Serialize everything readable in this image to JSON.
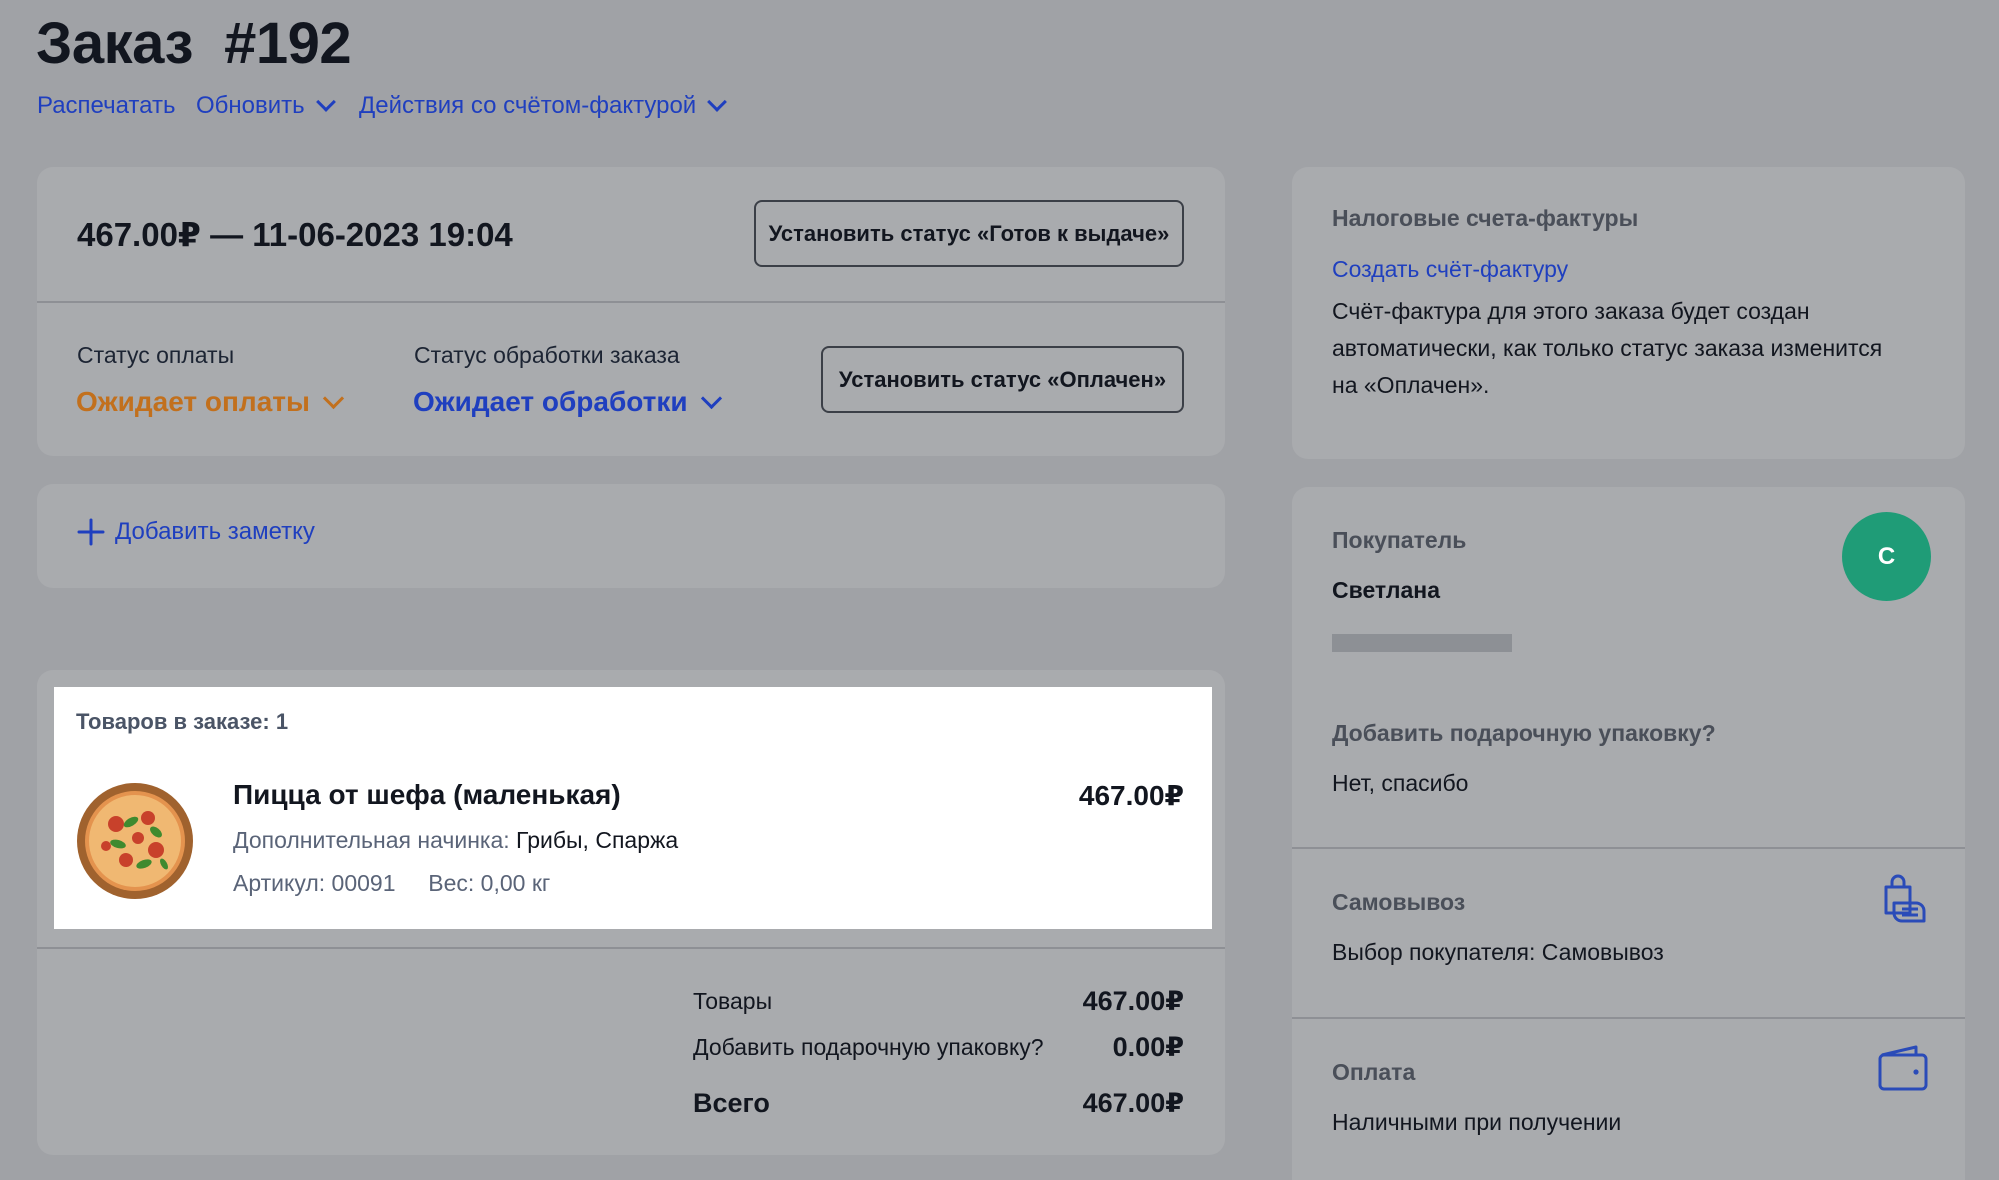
{
  "header": {
    "title": "Заказ  #192",
    "print_link": "Распечатать",
    "refresh_link": "Обновить",
    "invoice_actions_link": "Действия со счётом-фактурой"
  },
  "order": {
    "summary": "467.00₽ — 11-06-2023 19:04",
    "set_ready_button": "Установить статус «Готов к выдаче»",
    "payment_status_label": "Статус оплаты",
    "payment_status_value": "Ожидает оплаты",
    "processing_status_label": "Статус обработки заказа",
    "processing_status_value": "Ожидает обработки",
    "set_paid_button": "Установить статус «Оплачен»"
  },
  "note": {
    "add_note_label": "Добавить заметку"
  },
  "items": {
    "count_label": "Товаров в заказе: 1",
    "list": [
      {
        "name": "Пицца от шефа (маленькая)",
        "price": "467.00₽",
        "extra_label": "Дополнительная начинка:",
        "extra_value": "Грибы, Спаржа",
        "sku": "Артикул: 00091",
        "weight": "Вес: 0,00 кг"
      }
    ]
  },
  "totals": {
    "goods_label": "Товары",
    "goods_value": "467.00₽",
    "gift_label": "Добавить подарочную упаковку?",
    "gift_value": "0.00₽",
    "total_label": "Всего",
    "total_value": "467.00₽"
  },
  "invoices": {
    "heading": "Налоговые счета-фактуры",
    "create_link": "Создать счёт-фактуру",
    "description_line1": "Счёт-фактура для этого заказа будет создан",
    "description_line2": "автоматически, как только статус заказа изменится",
    "description_line3": "на «Оплачен»."
  },
  "customer": {
    "heading": "Покупатель",
    "name": "Светлана",
    "avatar_letter": "С",
    "gift_question": "Добавить подарочную упаковку?",
    "gift_answer": "Нет, спасибо"
  },
  "delivery": {
    "heading": "Самовывоз",
    "value": "Выбор покупателя: Самовывоз",
    "icon": "bag-hand-icon"
  },
  "payment": {
    "heading": "Оплата",
    "value": "Наличными при получении",
    "icon": "wallet-icon"
  },
  "colors": {
    "background": "#a0a2a6",
    "card": "#a9abae",
    "link_blue": "#1f3fbf",
    "pending_orange": "#c2701d",
    "avatar_green": "#1f9c77"
  }
}
